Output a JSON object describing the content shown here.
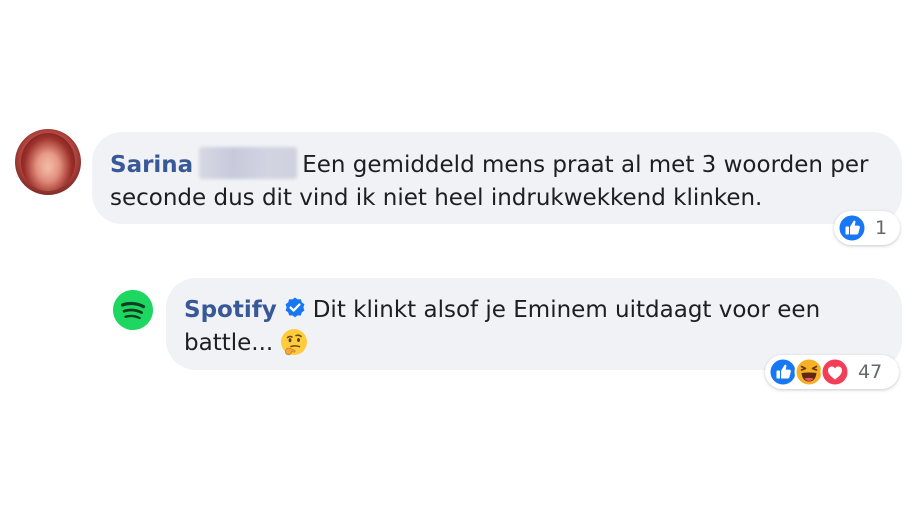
{
  "comments": [
    {
      "author": "Sarina",
      "author_name_redacted": true,
      "text": "Een gemiddeld mens praat al met 3 woorden per seconde dus dit vind ik niet heel indrukwekkend klinken.",
      "text_line1": "Een gemiddeld mens praat al met 3 woorden per",
      "text_line2": "seconde dus dit vind ik niet heel indrukwekkend klinken.",
      "avatar_icon": "profile-photo",
      "reactions": {
        "icons": [
          "like-icon"
        ],
        "count": "1"
      }
    },
    {
      "author": "Spotify",
      "verified": true,
      "verified_icon": "verified-badge-icon",
      "text_line1": "Dit klinkt alsof je Eminem uitdaagt voor een",
      "text_line2": "battle...",
      "emoji": "thinking-emoji",
      "avatar_icon": "spotify-logo-icon",
      "reactions": {
        "icons": [
          "like-icon",
          "haha-icon",
          "love-icon"
        ],
        "count": "47"
      }
    }
  ],
  "colors": {
    "bubble_bg": "#f0f2f5",
    "author": "#385898",
    "text": "#1c1e21",
    "like_blue": "#1877f2",
    "love_red": "#f33e58",
    "haha_yellow": "#f7b125",
    "spotify_green": "#1ed760",
    "verified_blue": "#1877f2",
    "count_gray": "#65676b"
  }
}
